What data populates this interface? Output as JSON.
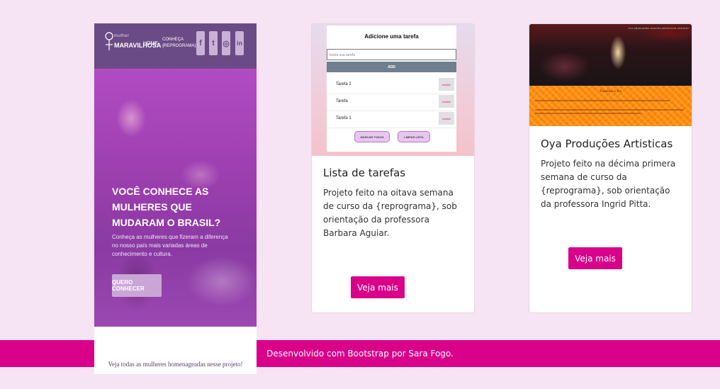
{
  "colors": {
    "background": "#f6e3f3",
    "accent": "#d9008a",
    "site_purple": "#6b4b85"
  },
  "card1": {
    "nav_brand_top": "mulher",
    "nav_brand": "MARAVILHOSA",
    "nav_home": "HOME",
    "nav_link": "CONHEÇA {REPROGRAMA}",
    "social_icons": [
      "facebook-icon",
      "twitter-icon",
      "instagram-icon",
      "linkedin-icon"
    ],
    "social_glyphs": [
      "f",
      "t",
      "◎",
      "in"
    ],
    "headline": "VOCÊ CONHECE AS MULHERES QUE MUDARAM O BRASIL?",
    "subtext": "Conheça as mulheres que fizeram a diferença no nosso país mais variadas áreas de conhecimento e cultura.",
    "button": "QUERO CONHECER",
    "bottom_text": "Veja todas as mulheres homenageadas nesse projeto!"
  },
  "card2": {
    "app_title": "Adicione uma tarefa",
    "input_placeholder": "Insira sua tarefa",
    "add_button": "ADD",
    "tasks": [
      "Tarefa 2",
      "Tarefa",
      "Tarefa 1"
    ],
    "delete_label": "excluir",
    "mark_all": "MARCAR TODOS",
    "clear_list": "LIMPAR LISTA",
    "title": "Lista de tarefas",
    "text": "Projeto feito na oitava semana de curso da {reprograma}, sob orientação da professora Barbara Aguiar.",
    "button": "Veja mais"
  },
  "card3": {
    "nav_links": "OYA PRODUÇÕES   GRUPOS ARTÍSTICOS   CONTATO",
    "heading": "Trabalhos e Pro",
    "title": "Oya Produções Artisticas",
    "text": "Projeto feito na décima primera semana de curso da {reprograma}, sob orientação da professora Ingrid Pitta.",
    "button": "Veja mais"
  },
  "footer": "Desenvolvido com Bootstrap por Sara Fogo."
}
